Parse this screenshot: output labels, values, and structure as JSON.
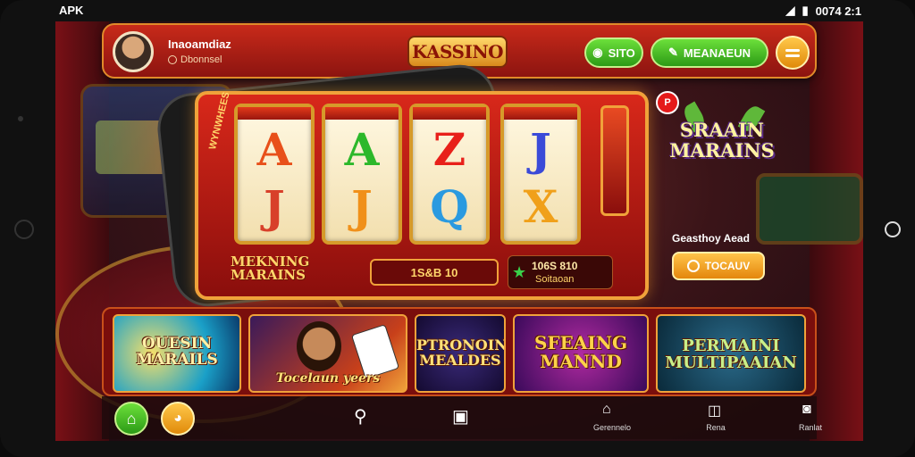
{
  "status": {
    "left": "APK",
    "right": "0074 2:1"
  },
  "header": {
    "user_name": "Inaoamdiaz",
    "user_sub": "Dbonnsel",
    "logo": "KASSINO",
    "btn_sito": "SITO",
    "btn_main": "MEANAEUN"
  },
  "slot": {
    "reel1": [
      "A",
      "J"
    ],
    "reel2": [
      "A",
      "J"
    ],
    "reel3": [
      "Z",
      "Q"
    ],
    "reel4": [
      "J",
      "X"
    ],
    "side_text": "WYNWHEES",
    "brand": "MEKNING\nMARAINS",
    "credit": "1S&B 10",
    "win_value": "106S 810",
    "win_label": "Soitaoan"
  },
  "promo": {
    "badge": "P",
    "title": "SRAAIN\nMARAINS",
    "caption": "Geasthoy Aead",
    "button": "TOCAUV"
  },
  "cards": [
    {
      "title": "OUESIN\nMARAILS"
    },
    {
      "title": "Tocelaun yeers"
    },
    {
      "title": "PTRONOIN\nMEALDES"
    },
    {
      "title": "SFEAING\nMANND"
    },
    {
      "title": "PERMAINI\nMULTIPAAIAN"
    }
  ],
  "nav": {
    "item3_label": "Gerennelo",
    "item4_label": "Rena",
    "item5_label": "Ranlat"
  },
  "colors": {
    "accent": "#c82a1a",
    "gold": "#f0a23a",
    "green": "#3ab81a"
  }
}
